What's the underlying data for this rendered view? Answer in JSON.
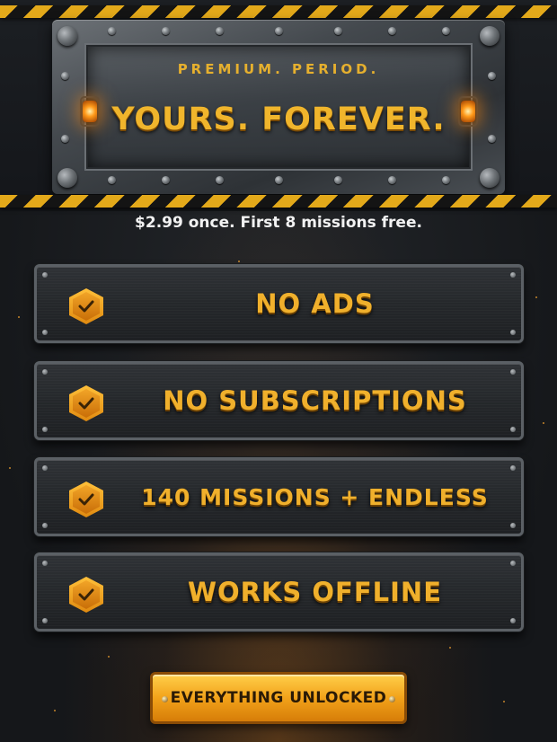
{
  "header": {
    "kicker": "PREMIUM. PERIOD.",
    "headline": "YOURS. FOREVER."
  },
  "subtitle": "$2.99 once. First 8 missions free.",
  "features": [
    {
      "label": "NO ADS",
      "icon": "check-badge-icon"
    },
    {
      "label": "NO SUBSCRIPTIONS",
      "icon": "check-badge-icon"
    },
    {
      "label": "140 MISSIONS + ENDLESS",
      "icon": "check-badge-icon"
    },
    {
      "label": "WORKS OFFLINE",
      "icon": "check-badge-icon"
    }
  ],
  "cta": {
    "label": "EVERYTHING UNLOCKED"
  },
  "colors": {
    "accent_gold": "#f0b02c",
    "hazard_yellow": "#e3a91a",
    "background": "#17191c"
  }
}
